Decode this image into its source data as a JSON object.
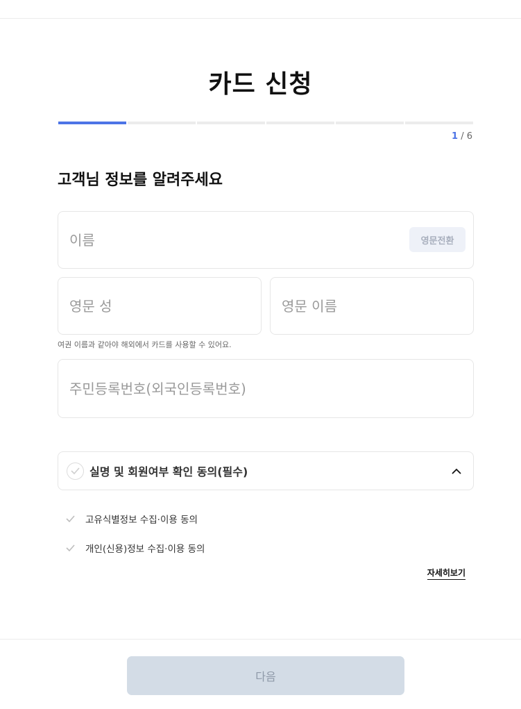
{
  "page": {
    "title": "카드 신청",
    "step_current": "1",
    "step_separator": "/",
    "step_total": "6",
    "progress": 0.1667
  },
  "form": {
    "heading": "고객님 정보를 알려주세요",
    "name_placeholder": "이름",
    "name_toggle_label": "영문전환",
    "last_name_en_placeholder": "영문 성",
    "first_name_en_placeholder": "영문 이름",
    "name_hint": "여권 이름과 같아야 해외에서 카드를 사용할 수 있어요.",
    "rrn_placeholder": "주민등록번호(외국인등록번호)"
  },
  "consent": {
    "title": "실명 및 회원여부 확인 동의(필수)",
    "items": [
      {
        "label": "고유식별정보 수집·이용 동의"
      },
      {
        "label": "개인(신용)정보 수집·이용 동의"
      }
    ],
    "detail_link": "자세히보기"
  },
  "footer": {
    "next_label": "다음"
  },
  "colors": {
    "accent": "#4d74e6",
    "track": "#ececec",
    "disabled_button": "#d3dce6"
  }
}
